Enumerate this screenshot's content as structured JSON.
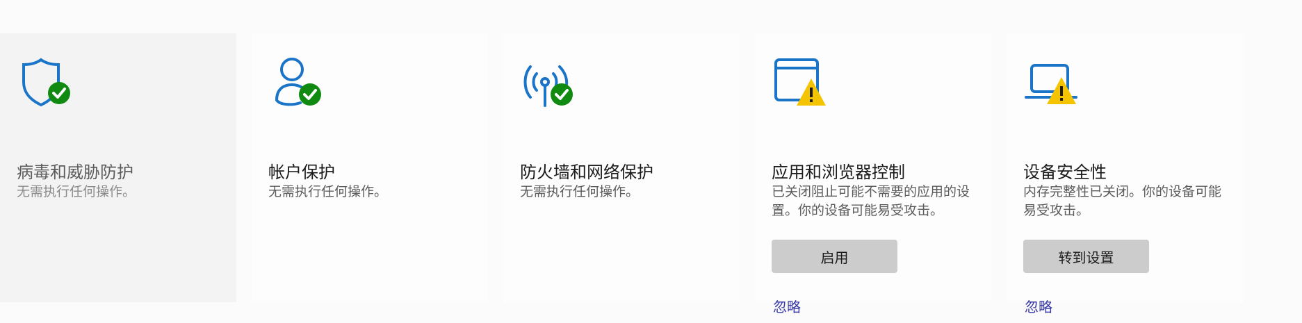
{
  "tiles": [
    {
      "id": "virus",
      "icon": "shield-check-icon",
      "title": "病毒和威胁防护",
      "description": "无需执行任何操作。"
    },
    {
      "id": "account",
      "icon": "person-check-icon",
      "title": "帐户保护",
      "description": "无需执行任何操作。"
    },
    {
      "id": "firewall",
      "icon": "antenna-check-icon",
      "title": "防火墙和网络保护",
      "description": "无需执行任何操作。"
    },
    {
      "id": "app-browser",
      "icon": "window-warning-icon",
      "title": "应用和浏览器控制",
      "description": "已关闭阻止可能不需要的应用的设置。你的设备可能易受攻击。",
      "button_label": "启用",
      "link_label": "忽略"
    },
    {
      "id": "device-security",
      "icon": "laptop-warning-icon",
      "title": "设备安全性",
      "description": "内存完整性已关闭。你的设备可能易受攻击。",
      "button_label": "转到设置",
      "link_label": "忽略"
    }
  ],
  "colors": {
    "icon_blue": "#1a75c8",
    "check_green": "#118a11",
    "warning_yellow": "#f5c400",
    "link": "#3838a8",
    "button": "#cccccc"
  }
}
